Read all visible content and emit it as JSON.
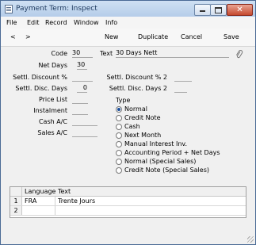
{
  "window": {
    "title": "Payment Term: Inspect"
  },
  "menu": [
    "File",
    "Edit",
    "Record",
    "Window",
    "Info"
  ],
  "toolbar": {
    "prev": "<",
    "next": ">",
    "new": "New",
    "duplicate": "Duplicate",
    "cancel": "Cancel",
    "save": "Save"
  },
  "form": {
    "code_label": "Code",
    "code_value": "30",
    "text_label": "Text",
    "text_value": "30 Days Nett",
    "net_days_label": "Net Days",
    "net_days_value": "30",
    "settl_discount_label": "Settl. Discount %",
    "settl_discount_value": "",
    "settl_discount2_label": "Settl. Discount % 2",
    "settl_discount2_value": "",
    "settl_disc_days_label": "Settl. Disc. Days",
    "settl_disc_days_value": "0",
    "settl_disc_days2_label": "Settl. Disc. Days 2",
    "settl_disc_days2_value": "",
    "price_list_label": "Price List",
    "price_list_value": "",
    "instalment_label": "Instalment",
    "instalment_value": "",
    "cash_ac_label": "Cash A/C",
    "cash_ac_value": "",
    "sales_ac_label": "Sales A/C",
    "sales_ac_value": "",
    "type_label": "Type"
  },
  "type_options": [
    {
      "label": "Normal",
      "selected": true
    },
    {
      "label": "Credit Note",
      "selected": false
    },
    {
      "label": "Cash",
      "selected": false
    },
    {
      "label": "Next Month",
      "selected": false
    },
    {
      "label": "Manual Interest Inv.",
      "selected": false
    },
    {
      "label": "Accounting Period + Net Days",
      "selected": false
    },
    {
      "label": "Normal (Special Sales)",
      "selected": false
    },
    {
      "label": "Credit Note (Special Sales)",
      "selected": false
    }
  ],
  "grid": {
    "columns": [
      "Language",
      "Text"
    ],
    "rows": [
      {
        "num": "1",
        "language": "FRA",
        "text": "Trente Jours"
      },
      {
        "num": "2",
        "language": "",
        "text": ""
      }
    ]
  },
  "icons": {
    "attachment": "paperclip-icon",
    "window_icon": "document-icon"
  }
}
